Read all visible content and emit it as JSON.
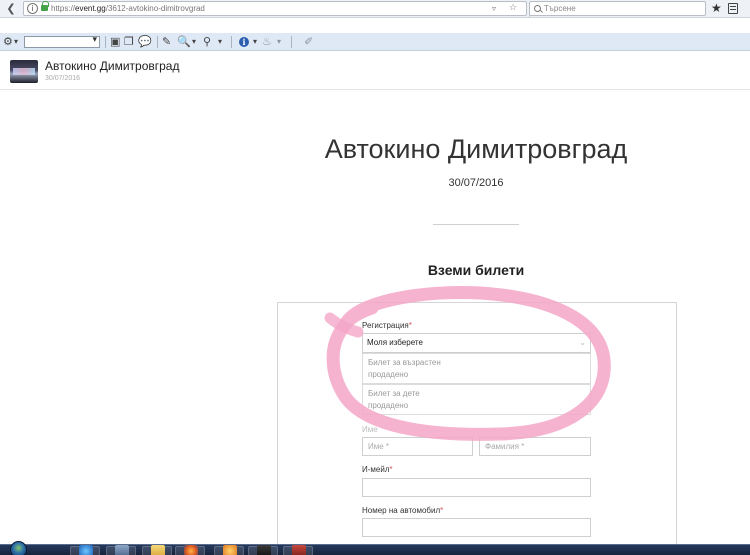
{
  "browser": {
    "url_prefix": "https://",
    "url_host": "event.gg",
    "url_path": "/3612-avtokino-dimitrovgrad",
    "search_placeholder": "Търсене"
  },
  "site": {
    "title": "Автокино Димитровград",
    "date": "30/07/2016"
  },
  "event": {
    "title": "Автокино Димитровград",
    "date": "30/07/2016"
  },
  "tickets": {
    "heading": "Вземи билети",
    "registration_label": "Регистрация",
    "required_mark": "*",
    "select_value": "Моля изберете",
    "options": [
      {
        "name": "Билет за възрастен",
        "status": "продадено"
      },
      {
        "name": "Билет за дете",
        "status": "продадено"
      }
    ]
  },
  "form": {
    "name_label": "Име",
    "first_name_placeholder": "Име *",
    "last_name_placeholder": "Фамилия *",
    "email_label": "И-мейл",
    "car_label": "Номер на автомобил"
  },
  "annotation": {
    "color": "#f4a6c8"
  }
}
